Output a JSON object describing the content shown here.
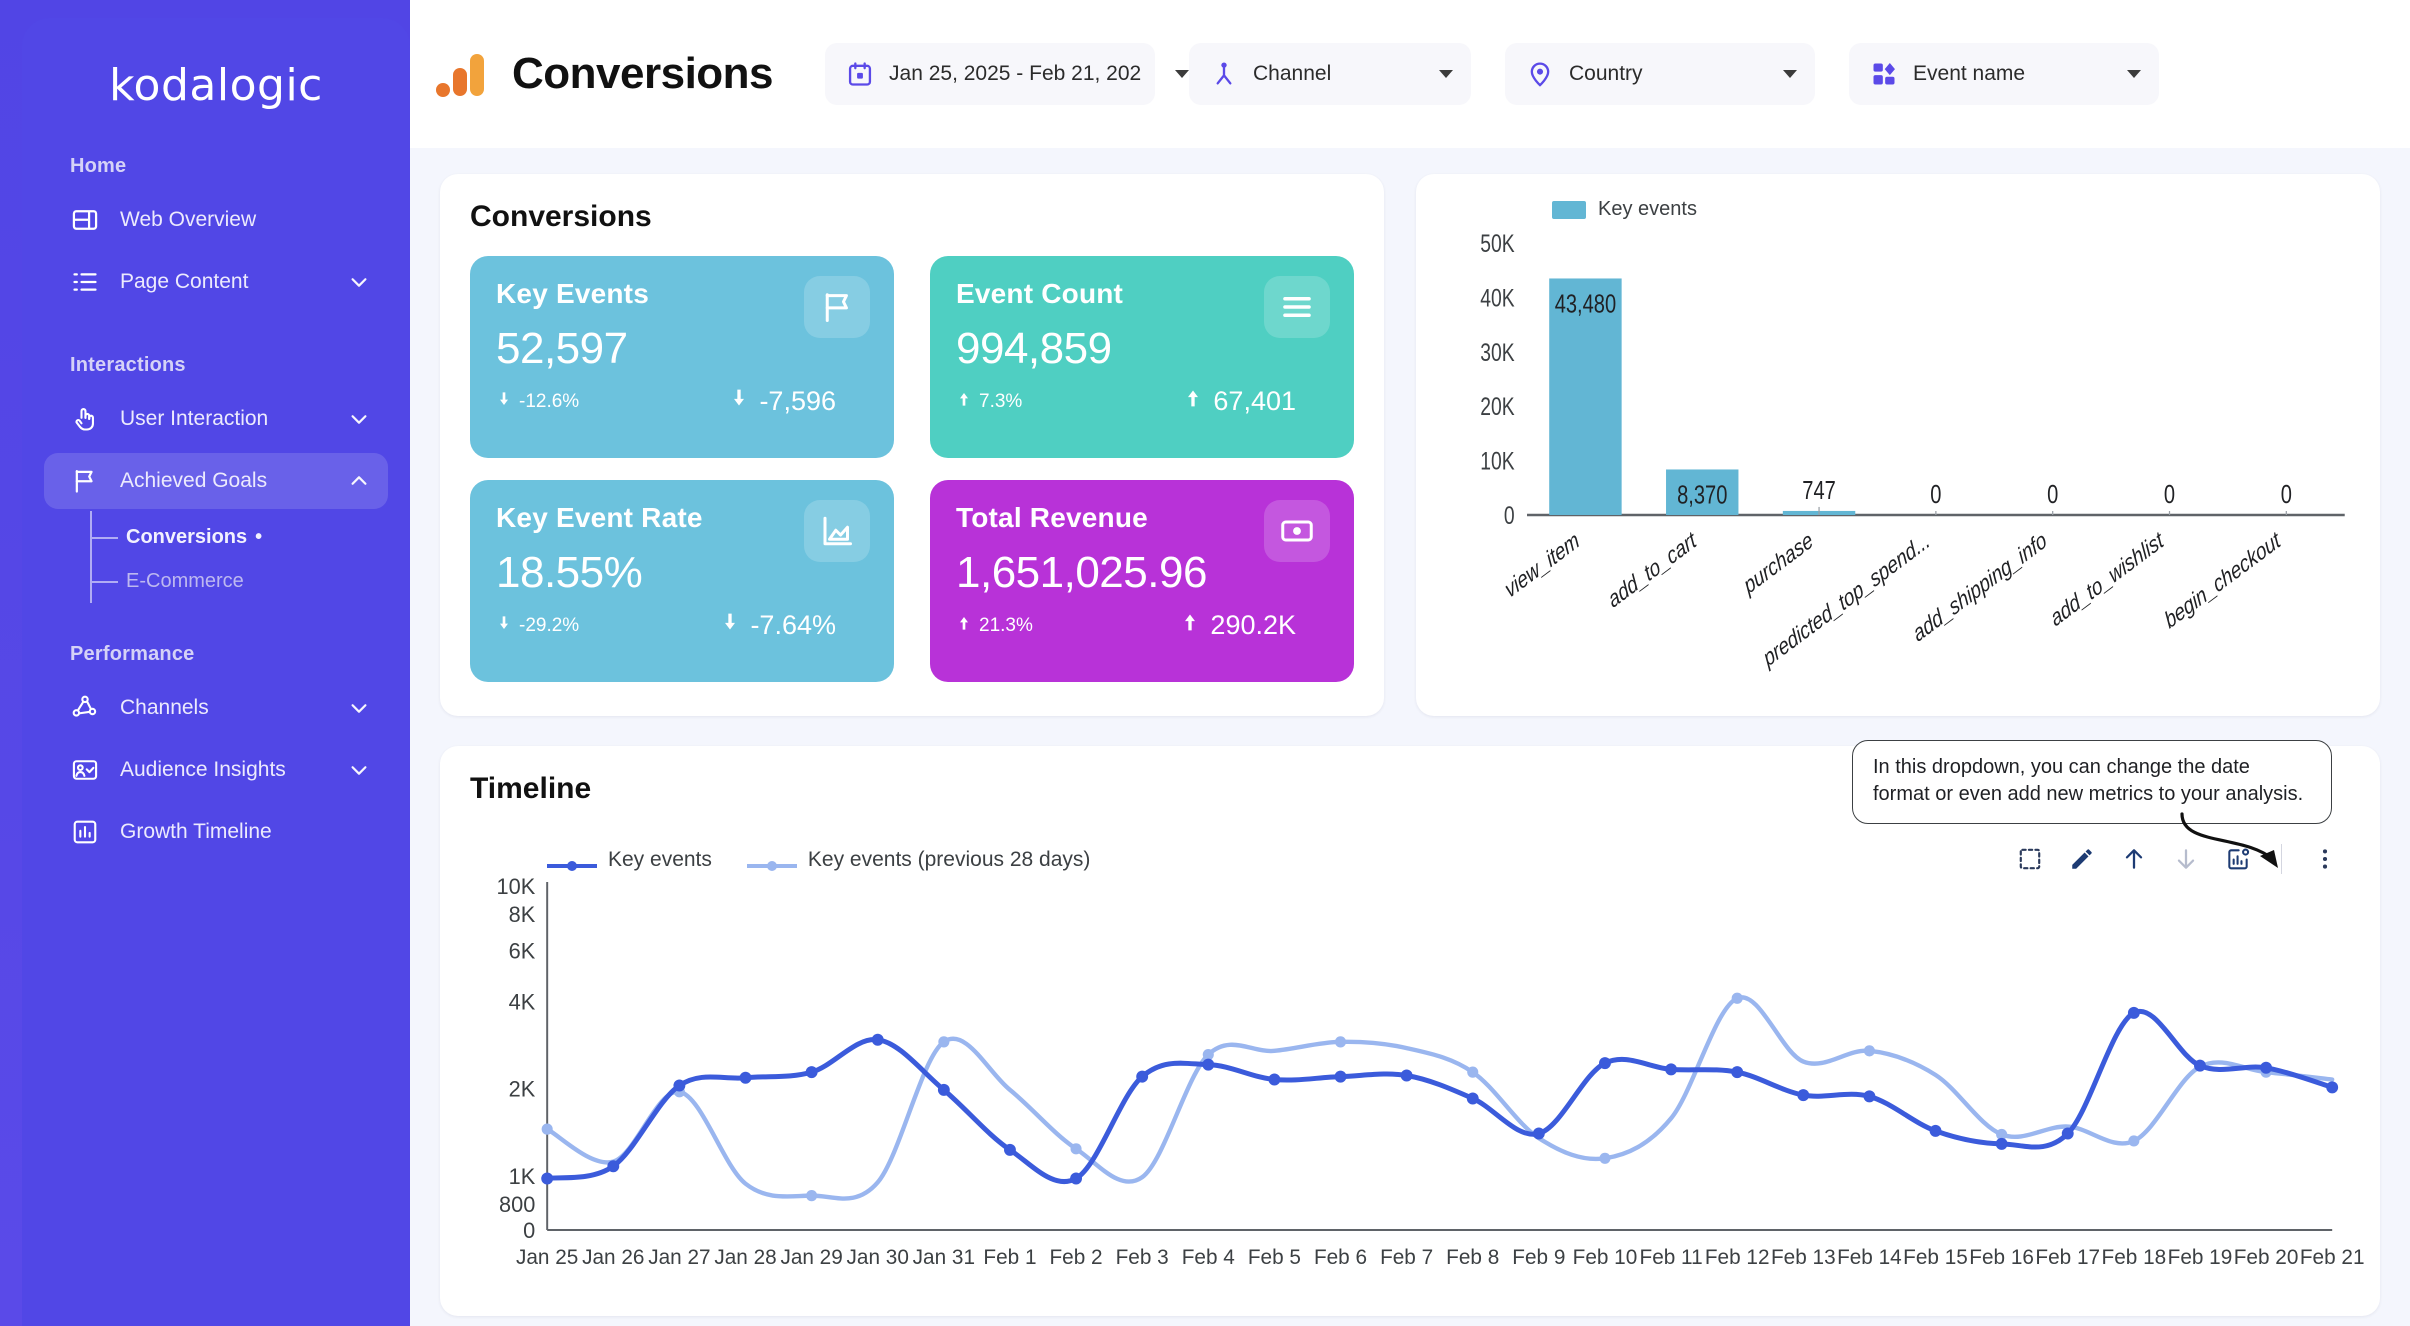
{
  "sidebar": {
    "logo": "kodalogic",
    "sections": [
      {
        "label": "Home",
        "items": [
          {
            "label": "Web Overview",
            "icon": "web-overview-icon",
            "expandable": false
          },
          {
            "label": "Page Content",
            "icon": "page-content-icon",
            "expandable": true,
            "chevron": "down"
          }
        ]
      },
      {
        "label": "Interactions",
        "items": [
          {
            "label": "User Interaction",
            "icon": "hand-pointer-icon",
            "expandable": true,
            "chevron": "down"
          },
          {
            "label": "Achieved Goals",
            "icon": "flag-icon",
            "expandable": true,
            "chevron": "up",
            "active": true
          }
        ],
        "subitems": [
          {
            "label": "Conversions",
            "current": true,
            "marker": "•"
          },
          {
            "label": "E-Commerce",
            "current": false
          }
        ]
      },
      {
        "label": "Performance",
        "items": [
          {
            "label": "Channels",
            "icon": "share-nodes-icon",
            "expandable": true,
            "chevron": "down"
          },
          {
            "label": "Audience Insights",
            "icon": "audience-icon",
            "expandable": true,
            "chevron": "down"
          },
          {
            "label": "Growth Timeline",
            "icon": "bar-chart-icon",
            "expandable": false
          }
        ]
      }
    ]
  },
  "header": {
    "title": "Conversions",
    "logo_icon": "google-analytics-icon",
    "filters": [
      {
        "label": "Jan 25, 2025 - Feb 21, 202",
        "icon": "calendar-icon"
      },
      {
        "label": "Channel",
        "icon": "channel-icon"
      },
      {
        "label": "Country",
        "icon": "location-pin-icon"
      },
      {
        "label": "Event name",
        "icon": "event-blocks-icon"
      }
    ]
  },
  "conversions_card": {
    "title": "Conversions",
    "kpis": [
      {
        "label": "Key Events",
        "value": "52,597",
        "delta_pct": "-12.6%",
        "delta_abs": "-7,596",
        "direction": "down",
        "icon": "flag-icon",
        "color": "#6cc2dd"
      },
      {
        "label": "Key Event Rate",
        "value": "18.55%",
        "delta_pct": "-29.2%",
        "delta_abs": "-7.64%",
        "direction": "down",
        "icon": "area-chart-icon",
        "color": "#6cc2dd"
      },
      {
        "label": "Event Count",
        "value": "994,859",
        "delta_pct": "7.3%",
        "delta_abs": "67,401",
        "direction": "up",
        "icon": "list-lines-icon",
        "color": "#4fcfc2"
      },
      {
        "label": "Total Revenue",
        "value": "1,651,025.96",
        "delta_pct": "21.3%",
        "delta_abs": "290.2K",
        "direction": "up",
        "icon": "banknote-icon",
        "color": "#b832d8"
      }
    ]
  },
  "timeline_card": {
    "title": "Timeline",
    "callout": "In this dropdown, you can change the date format or even add new metrics to your analysis.",
    "toolbar": [
      {
        "icon": "select-area-icon",
        "name": "select-area"
      },
      {
        "icon": "pencil-icon",
        "name": "edit"
      },
      {
        "icon": "arrow-up-icon",
        "name": "sort-ascending"
      },
      {
        "icon": "arrow-down-icon",
        "name": "sort-descending"
      },
      {
        "icon": "chart-settings-icon",
        "name": "chart-settings"
      },
      {
        "icon": "more-vertical-icon",
        "name": "more-options"
      }
    ]
  },
  "chart_data": [
    {
      "type": "bar",
      "title": "",
      "legend": [
        "Key events"
      ],
      "legend_position": "top-left",
      "categories": [
        "view_item",
        "add_to_cart",
        "purchase",
        "predicted_top_spend...",
        "add_shipping_info",
        "add_to_wishlist",
        "begin_checkout"
      ],
      "values": [
        43480,
        8370,
        747,
        0,
        0,
        0,
        0
      ],
      "value_labels": [
        "43,480",
        "8,370",
        "747",
        "0",
        "0",
        "0",
        "0"
      ],
      "ytick_labels": [
        "0",
        "10K",
        "20K",
        "30K",
        "40K",
        "50K"
      ],
      "ytick_values": [
        0,
        10000,
        20000,
        30000,
        40000,
        50000
      ],
      "ylim": [
        0,
        50000
      ],
      "xlabel": "",
      "ylabel": "",
      "grid": false,
      "bar_color": "#62b6d4"
    },
    {
      "type": "line",
      "title": "Timeline",
      "legend_position": "top-left",
      "x": [
        "Jan 25",
        "Jan 26",
        "Jan 27",
        "Jan 28",
        "Jan 29",
        "Jan 30",
        "Jan 31",
        "Feb 1",
        "Feb 2",
        "Feb 3",
        "Feb 4",
        "Feb 5",
        "Feb 6",
        "Feb 7",
        "Feb 8",
        "Feb 9",
        "Feb 10",
        "Feb 11",
        "Feb 12",
        "Feb 13",
        "Feb 14",
        "Feb 15",
        "Feb 16",
        "Feb 17",
        "Feb 18",
        "Feb 19",
        "Feb 20",
        "Feb 21"
      ],
      "yscale": "log",
      "ytick_labels": [
        "800",
        "1K",
        "2K",
        "4K",
        "6K",
        "8K",
        "10K"
      ],
      "ytick_values": [
        800,
        1000,
        2000,
        4000,
        6000,
        8000,
        10000
      ],
      "ylim": [
        800,
        10000
      ],
      "axis_zero_label": "0",
      "grid": false,
      "series": [
        {
          "name": "Key events",
          "color": "#3b5bdb",
          "values": [
            980,
            1080,
            2050,
            2180,
            2280,
            2950,
            1980,
            1230,
            980,
            2200,
            2420,
            2150,
            2200,
            2220,
            1850,
            1400,
            2450,
            2330,
            2280,
            1900,
            1880,
            1430,
            1290,
            1400,
            3650,
            2400,
            2360,
            2020
          ]
        },
        {
          "name": "Key events (previous 28 days)",
          "color": "#9ab6ef",
          "values": [
            1450,
            1120,
            1950,
            940,
            855,
            950,
            2900,
            1980,
            1240,
            990,
            2620,
            2700,
            2900,
            2760,
            2280,
            1350,
            1150,
            1580,
            4100,
            2480,
            2700,
            2230,
            1390,
            1480,
            1320,
            2380,
            2280,
            2150,
            2250
          ]
        }
      ]
    }
  ]
}
